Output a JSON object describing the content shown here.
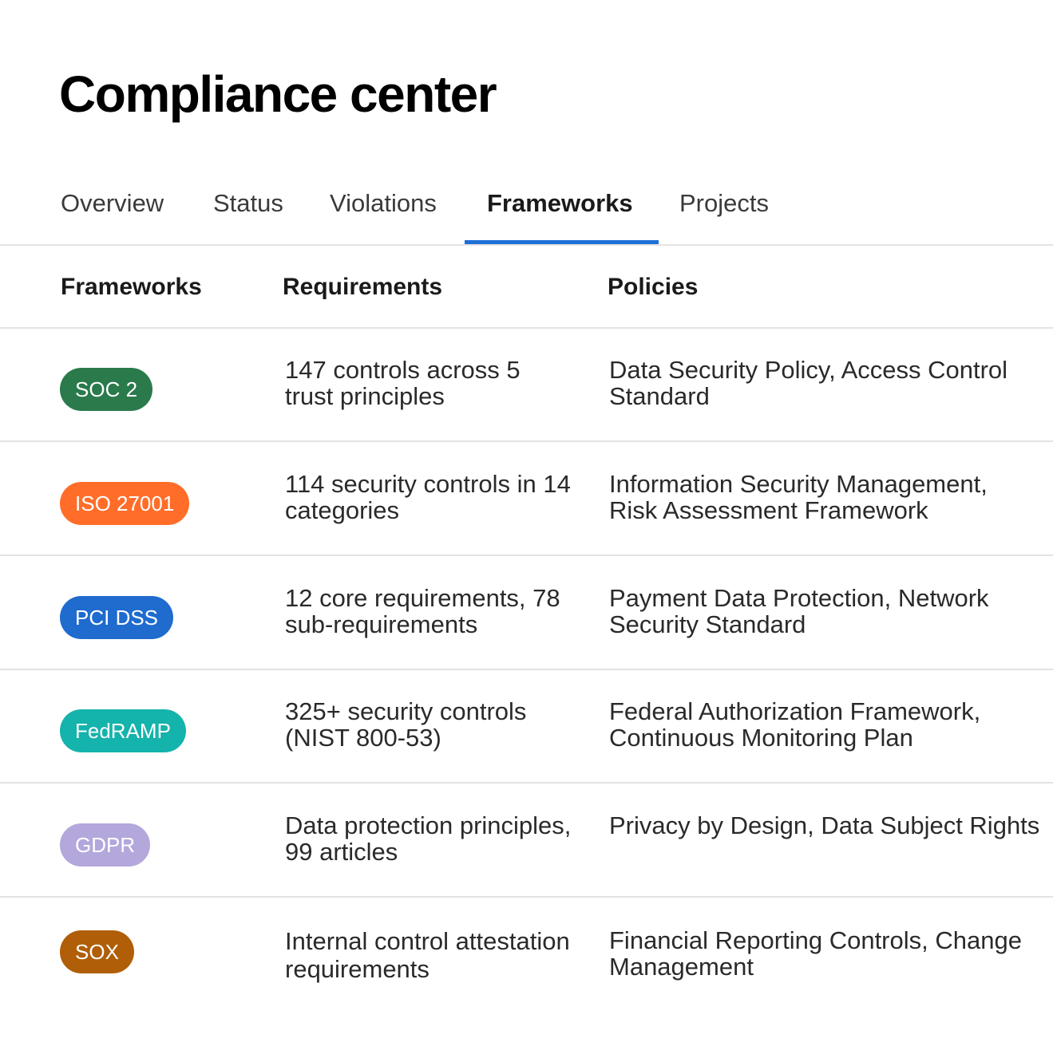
{
  "page_title": "Compliance center",
  "tabs": [
    {
      "label": "Overview",
      "active": false
    },
    {
      "label": "Status",
      "active": false
    },
    {
      "label": "Violations",
      "active": false
    },
    {
      "label": "Frameworks",
      "active": true
    },
    {
      "label": "Projects",
      "active": false
    }
  ],
  "accent_color": "#1e6fd6",
  "table": {
    "headers": [
      "Frameworks",
      "Requirements",
      "Policies"
    ],
    "rows": [
      {
        "framework": "SOC 2",
        "badge_color": "#2a7a4c",
        "requirements": "147 controls across 5 trust principles",
        "policies": "Data Security Policy, Access Control Standard"
      },
      {
        "framework": "ISO 27001",
        "badge_color": "#ff6d28",
        "requirements": "114 security controls in 14 categories",
        "policies": "Information Security Management, Risk Assessment Framework"
      },
      {
        "framework": "PCI DSS",
        "badge_color": "#1f6bce",
        "requirements": "12 core requirements, 78 sub-requirements",
        "policies": "Payment Data Protection, Network Security Standard"
      },
      {
        "framework": "FedRAMP",
        "badge_color": "#14b3ab",
        "requirements": "325+ security controls (NIST 800-53)",
        "policies": "Federal Authorization Framework, Continuous Monitoring Plan"
      },
      {
        "framework": "GDPR",
        "badge_color": "#b3a7dc",
        "requirements": "Data protection principles, 99 articles",
        "policies": "Privacy by Design, Data Subject Rights"
      },
      {
        "framework": "SOX",
        "badge_color": "#b05e07",
        "requirements": "Internal control attestation requirements",
        "policies": "Financial Reporting Controls, Change Management"
      }
    ]
  }
}
